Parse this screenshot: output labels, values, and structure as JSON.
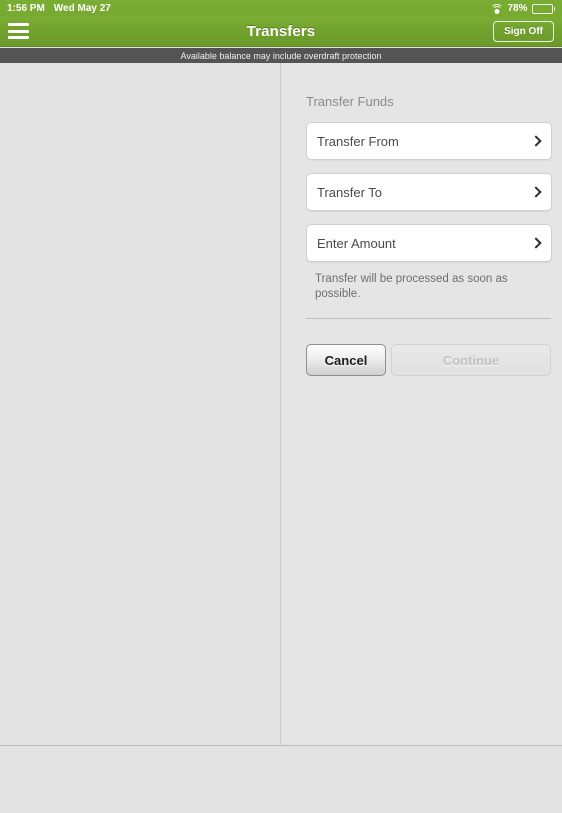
{
  "status_bar": {
    "time": "1:56 PM",
    "date": "Wed May 27",
    "wifi_icon": "wifi-icon",
    "battery_percent": "78%",
    "battery_icon": "battery-icon"
  },
  "header": {
    "menu_icon": "hamburger-menu-icon",
    "title": "Transfers",
    "sign_off_label": "Sign Off"
  },
  "notice": {
    "text": "Available balance may include overdraft protection"
  },
  "main": {
    "section_title": "Transfer Funds",
    "fields": [
      {
        "label": "Transfer From",
        "chevron_icon": "chevron-right-icon"
      },
      {
        "label": "Transfer To",
        "chevron_icon": "chevron-right-icon"
      },
      {
        "label": "Enter Amount",
        "chevron_icon": "chevron-right-icon"
      }
    ],
    "helper_text": "Transfer will be processed as soon as possible.",
    "buttons": {
      "cancel_label": "Cancel",
      "continue_label": "Continue"
    }
  },
  "colors": {
    "brand_green": "#76a730",
    "notice_bar": "#545454",
    "page_background": "#e4e3e3",
    "field_background": "#ffffff",
    "disabled_text": "#c2c1c1"
  }
}
